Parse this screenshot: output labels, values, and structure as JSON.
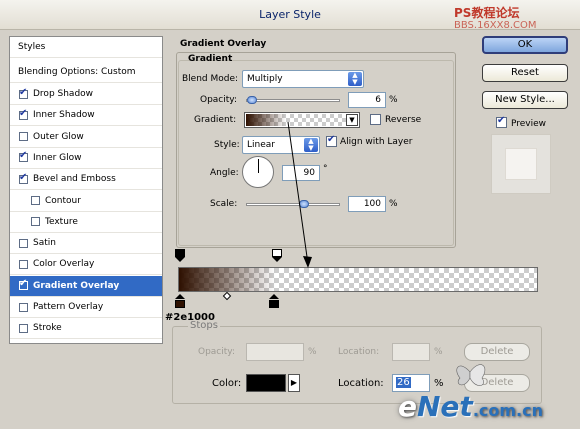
{
  "window": {
    "title": "Layer Style"
  },
  "watermark": {
    "top": "PS教程论坛",
    "top2": "BBS.16XX8.COM",
    "bottom_e": "e",
    "bottom_net": "Net",
    "bottom_rest": ".com.cn"
  },
  "sidebar": {
    "header": "Styles",
    "blending": "Blending Options: Custom",
    "items": [
      {
        "label": "Drop Shadow",
        "checked": true
      },
      {
        "label": "Inner Shadow",
        "checked": true
      },
      {
        "label": "Outer Glow",
        "checked": false
      },
      {
        "label": "Inner Glow",
        "checked": true
      },
      {
        "label": "Bevel and Emboss",
        "checked": true
      },
      {
        "label": "Contour",
        "checked": false
      },
      {
        "label": "Texture",
        "checked": false
      },
      {
        "label": "Satin",
        "checked": false
      },
      {
        "label": "Color Overlay",
        "checked": false
      },
      {
        "label": "Gradient Overlay",
        "checked": true
      },
      {
        "label": "Pattern Overlay",
        "checked": false
      },
      {
        "label": "Stroke",
        "checked": false
      }
    ]
  },
  "panel": {
    "title": "Gradient Overlay",
    "subtitle": "Gradient",
    "blend_mode_label": "Blend Mode:",
    "blend_mode_value": "Multiply",
    "opacity_label": "Opacity:",
    "opacity_value": "6",
    "opacity_fraction": 0.06,
    "percent": "%",
    "gradient_label": "Gradient:",
    "reverse_label": "Reverse",
    "reverse_checked": false,
    "style_label": "Style:",
    "style_value": "Linear",
    "align_label": "Align with Layer",
    "align_checked": true,
    "angle_label": "Angle:",
    "angle_value": "90",
    "degree": "°",
    "scale_label": "Scale:",
    "scale_value": "100",
    "scale_fraction": 0.5
  },
  "buttons": {
    "ok": "OK",
    "reset": "Reset",
    "new_style": "New Style...",
    "preview_label": "Preview",
    "preview_checked": true
  },
  "editor": {
    "stop_color_hex": "#2e1000",
    "stop_label": "#2e1000",
    "stops_title": "Stops",
    "opacity_label": "Opacity:",
    "location_label": "Location:",
    "delete_label": "Delete",
    "color_label": "Color:",
    "location_value": "26",
    "percent": "%"
  },
  "colors": {
    "accent": "#316ac5",
    "stop": "#2e1000"
  }
}
